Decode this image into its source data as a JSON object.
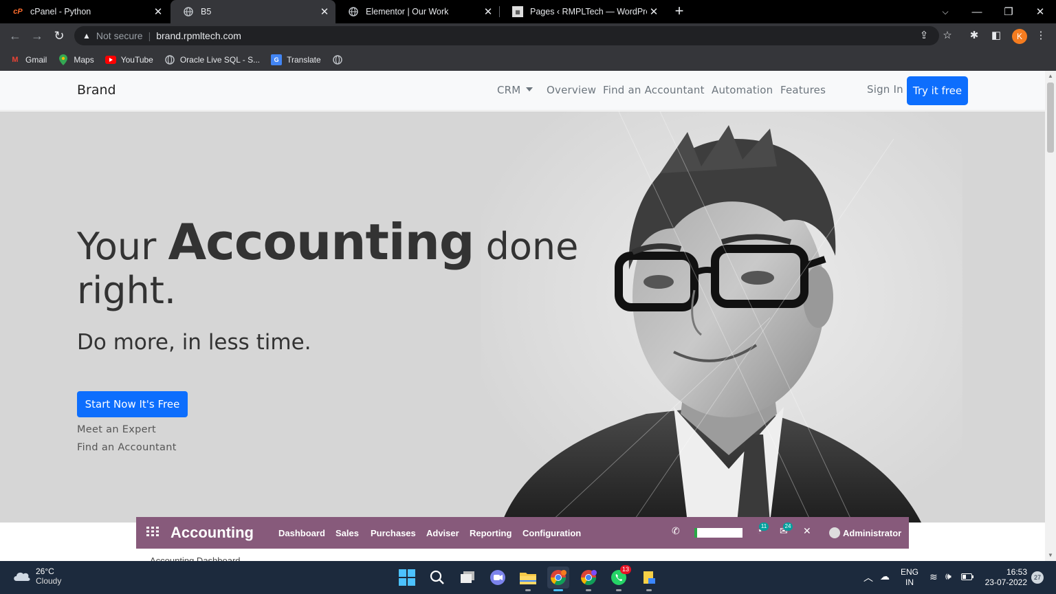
{
  "browser": {
    "tabs": [
      {
        "title": "cPanel - Python",
        "icon": "cpanel-icon"
      },
      {
        "title": "B5",
        "icon": "globe-icon"
      },
      {
        "title": "Elementor | Our Work",
        "icon": "globe-icon"
      },
      {
        "title": "Pages ‹ RMPLTech — WordPress",
        "icon": "rmpl-icon"
      }
    ],
    "address": {
      "security": "Not secure",
      "url": "brand.rpmltech.com"
    },
    "profile_initial": "K",
    "bookmarks": [
      {
        "label": "Gmail",
        "icon": "gmail-icon"
      },
      {
        "label": "Maps",
        "icon": "maps-icon"
      },
      {
        "label": "YouTube",
        "icon": "youtube-icon"
      },
      {
        "label": "Oracle Live SQL - S...",
        "icon": "globe-icon"
      },
      {
        "label": "Translate",
        "icon": "translate-icon"
      }
    ]
  },
  "site": {
    "brand": "Brand",
    "nav": {
      "crm": "CRM",
      "overview": "Overview",
      "find_accountant": "Find an Accountant",
      "automation": "Automation",
      "features": "Features",
      "sign_in": "Sign In",
      "try_free": "Try it free"
    },
    "hero": {
      "title_pre": "Your",
      "title_big": "Accounting",
      "title_post": "done",
      "title_line2": "right.",
      "subtitle": "Do more, in less time.",
      "cta": "Start Now It's Free",
      "link_expert": "Meet an Expert",
      "link_accountant": "Find an Accountant"
    },
    "odoo": {
      "app": "Accounting",
      "menu": [
        "Dashboard",
        "Sales",
        "Purchases",
        "Adviser",
        "Reporting",
        "Configuration"
      ],
      "badge_activity": "11",
      "badge_messages": "24",
      "user": "Administrator",
      "below_text": "Accounting Dashboard"
    }
  },
  "taskbar": {
    "weather_temp": "26°C",
    "weather_desc": "Cloudy",
    "whatsapp_badge": "13",
    "lang_top": "ENG",
    "lang_bottom": "IN",
    "time": "16:53",
    "date": "23-07-2022",
    "notifications": "27"
  }
}
